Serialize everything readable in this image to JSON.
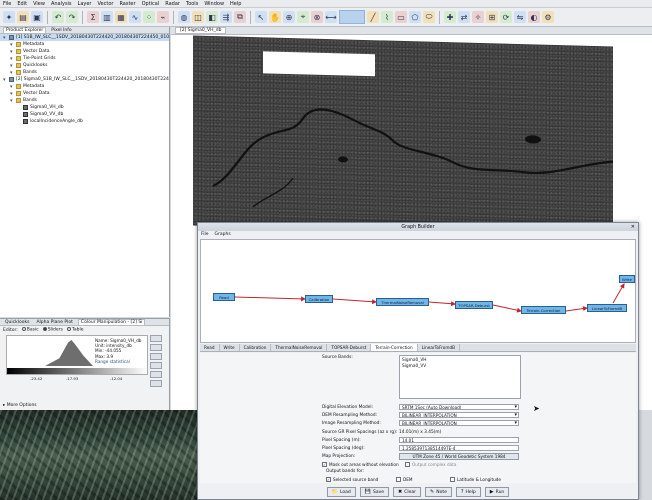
{
  "menubar": [
    "File",
    "Edit",
    "View",
    "Analysis",
    "Layer",
    "Vector",
    "Raster",
    "Optical",
    "Radar",
    "Tools",
    "Window",
    "Help"
  ],
  "left_panel": {
    "tabs": [
      "Product Explorer",
      "Pixel Info"
    ],
    "tree": [
      {
        "label": "[1] S1B_IW_SLC__1SDV_20180430T224420_20180430T224450_010733...",
        "icon": "product-icon",
        "indent": 0,
        "selected": true
      },
      {
        "label": "Metadata",
        "icon": "folder-icon",
        "indent": 1
      },
      {
        "label": "Vector Data",
        "icon": "folder-icon",
        "indent": 1
      },
      {
        "label": "Tie-Point Grids",
        "icon": "folder-icon",
        "indent": 1
      },
      {
        "label": "Quicklooks",
        "icon": "folder-icon",
        "indent": 1
      },
      {
        "label": "Bands",
        "icon": "folder-icon",
        "indent": 1
      },
      {
        "label": "[2] Sigma0_S1B_IW_SLC__1SDV_20180430T224420_20180430T224450_010733_013942_E3A1_Cal_Deb_TC_ML",
        "icon": "product-icon",
        "indent": 0
      },
      {
        "label": "Metadata",
        "icon": "folder-icon",
        "indent": 1
      },
      {
        "label": "Vector Data",
        "icon": "folder-icon",
        "indent": 1
      },
      {
        "label": "Bands",
        "icon": "folder-icon",
        "indent": 1
      },
      {
        "label": "Sigma0_VH_db",
        "icon": "band-icon",
        "indent": 2
      },
      {
        "label": "Sigma0_VV_db",
        "icon": "band-icon",
        "indent": 2
      },
      {
        "label": "localIncidenceAngle_db",
        "icon": "band-icon",
        "indent": 2
      }
    ]
  },
  "colour_panel": {
    "tabs": [
      "Quicklooks",
      "Alpha Plane Plot",
      "Colour Manipulation - [2] Si"
    ],
    "editor_label": "Editor:",
    "modes": [
      "Basic",
      "Sliders",
      "Table"
    ],
    "active_mode": "Sliders",
    "info": {
      "name": "Name: Sigma0_VH_db",
      "unit": "Unit: intensity_db",
      "min": "Min: -44.055",
      "max": "Max: 3.9",
      "more": "Range statistical"
    },
    "ticks": [
      "-23.42",
      "-17.93",
      "-12.04"
    ],
    "more_options": "More Options"
  },
  "image_view": {
    "tab_label": "[2] Sigma0_VH_db"
  },
  "graph_builder": {
    "title": "Graph Builder",
    "menu": [
      "File",
      "Graphs"
    ],
    "nodes": [
      "Read",
      "Calibration",
      "ThermalNoiseRemoval",
      "TOPSAR-Deburst",
      "Terrain-Correction",
      "LinearToFromdB",
      "Write"
    ],
    "tabs": [
      "Read",
      "Write",
      "Calibration",
      "ThermalNoiseRemoval",
      "TOPSAR-Deburst",
      "Terrain-Correction",
      "LinearToFromdB"
    ],
    "active_tab": "Terrain-Correction",
    "form": {
      "source_bands_label": "Source Bands:",
      "source_bands": [
        "Sigma0_VH",
        "Sigma0_VV"
      ],
      "dem_label": "Digital Elevation Model:",
      "dem_value": "SRTM 1Sec (Auto Download)",
      "dem_resampling_label": "DEM Resampling Method:",
      "dem_resampling_value": "BILINEAR_INTERPOLATION",
      "img_resampling_label": "Image Resampling Method:",
      "img_resampling_value": "BILINEAR_INTERPOLATION",
      "source_gr_label": "Source GR Pixel Spacings (az x rg):",
      "source_gr_value": "14.01(m) x 3.45(m)",
      "pixel_m_label": "Pixel Spacing (m):",
      "pixel_m_value": "14.01",
      "pixel_deg_label": "Pixel Spacing (deg):",
      "pixel_deg_value": "1.2585397138514497E-4",
      "map_proj_label": "Map Projection:",
      "map_proj_value": "UTM Zone 45 / World Geodetic System 1984",
      "mask_label": "Mask out areas without elevation",
      "output_complex_label": "Output complex data",
      "output_bands_label": "Output bands for:",
      "checks": [
        {
          "label": "Selected source band",
          "on": true
        },
        {
          "label": "DEM",
          "on": false
        },
        {
          "label": "Latitude & Longitude",
          "on": false
        },
        {
          "label": "Incidence angle from ellipsoid",
          "on": false
        },
        {
          "label": "Local incidence angle",
          "on": true
        },
        {
          "label": "Projected local incidence angle",
          "on": false
        }
      ]
    },
    "footer": [
      "Load",
      "Save",
      "Clear",
      "Note",
      "Help",
      "Run"
    ]
  }
}
